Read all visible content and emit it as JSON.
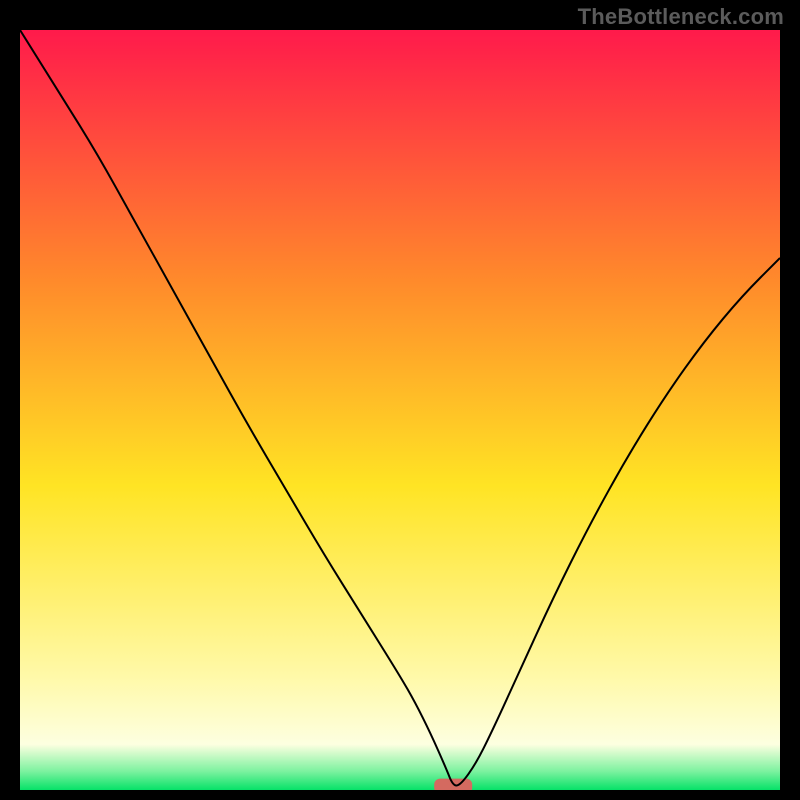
{
  "watermark": "TheBottleneck.com",
  "chart_data": {
    "type": "line",
    "title": "",
    "xlabel": "",
    "ylabel": "",
    "xlim": [
      0,
      100
    ],
    "ylim": [
      0,
      100
    ],
    "background_gradient": {
      "stops": [
        {
          "offset": 0.0,
          "color": "#ff1a4b"
        },
        {
          "offset": 0.33,
          "color": "#ff8a2b"
        },
        {
          "offset": 0.6,
          "color": "#ffe424"
        },
        {
          "offset": 0.85,
          "color": "#fff9a8"
        },
        {
          "offset": 0.94,
          "color": "#fdffe0"
        },
        {
          "offset": 0.975,
          "color": "#7ef2a0"
        },
        {
          "offset": 1.0,
          "color": "#06e268"
        }
      ]
    },
    "marker": {
      "x": 57,
      "y": 0.5,
      "w": 5,
      "h": 2,
      "color": "#d46a60"
    },
    "series": [
      {
        "name": "bottleneck-curve",
        "color": "#000000",
        "width": 2,
        "x": [
          0,
          5,
          10,
          15,
          20,
          25,
          30,
          35,
          40,
          45,
          50,
          52,
          54,
          56,
          57,
          58,
          60,
          62,
          65,
          70,
          75,
          80,
          85,
          90,
          95,
          100
        ],
        "y": [
          100,
          92,
          84,
          75,
          66,
          57,
          48,
          39.5,
          31,
          23,
          15,
          11.5,
          7.5,
          3,
          0.5,
          0.7,
          3.5,
          7.5,
          14,
          25,
          35,
          44,
          52,
          59,
          65,
          70
        ]
      }
    ]
  }
}
